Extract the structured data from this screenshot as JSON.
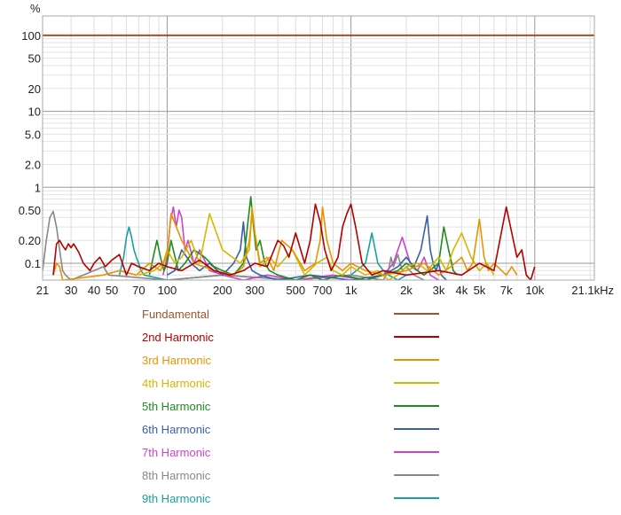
{
  "chart_data": {
    "type": "line",
    "ylabel": "%",
    "x_scale": "log",
    "y_scale": "log",
    "xlim": [
      21,
      21100
    ],
    "ylim": [
      0.06,
      180
    ],
    "x_ticks": [
      {
        "value": 21,
        "label": "21"
      },
      {
        "value": 30,
        "label": "30"
      },
      {
        "value": 40,
        "label": "40"
      },
      {
        "value": 50,
        "label": "50"
      },
      {
        "value": 70,
        "label": "70"
      },
      {
        "value": 100,
        "label": "100"
      },
      {
        "value": 200,
        "label": "200"
      },
      {
        "value": 300,
        "label": "300"
      },
      {
        "value": 500,
        "label": "500"
      },
      {
        "value": 700,
        "label": "700"
      },
      {
        "value": 1000,
        "label": "1k"
      },
      {
        "value": 2000,
        "label": "2k"
      },
      {
        "value": 3000,
        "label": "3k"
      },
      {
        "value": 4000,
        "label": "4k"
      },
      {
        "value": 5000,
        "label": "5k"
      },
      {
        "value": 7000,
        "label": "7k"
      },
      {
        "value": 10000,
        "label": "10k"
      },
      {
        "value": 21100,
        "label": "21.1kHz"
      }
    ],
    "y_ticks": [
      {
        "value": 100,
        "label": "100"
      },
      {
        "value": 50,
        "label": "50"
      },
      {
        "value": 20,
        "label": "20"
      },
      {
        "value": 10,
        "label": "10"
      },
      {
        "value": 5,
        "label": "5.0"
      },
      {
        "value": 2,
        "label": "2.0"
      },
      {
        "value": 1,
        "label": "1"
      },
      {
        "value": 0.5,
        "label": "0.50"
      },
      {
        "value": 0.2,
        "label": "0.20"
      },
      {
        "value": 0.1,
        "label": "0.1"
      }
    ],
    "grid": true,
    "legend_position": "bottom",
    "series": [
      {
        "name": "Fundamental",
        "color": "#a0522d",
        "x": [
          21,
          21100
        ],
        "y": [
          100,
          100
        ]
      },
      {
        "name": "2nd Harmonic",
        "color": "#b30000",
        "x": [
          24,
          25,
          26,
          27,
          28,
          29,
          30,
          31,
          33,
          35,
          38,
          40,
          43,
          46,
          50,
          55,
          60,
          64,
          70,
          80,
          90,
          100,
          120,
          150,
          180,
          220,
          260,
          300,
          350,
          400,
          430,
          460,
          500,
          560,
          600,
          640,
          680,
          720,
          780,
          850,
          900,
          950,
          1000,
          1060,
          1150,
          1300,
          1500,
          2000,
          3000,
          4000,
          5000,
          6000,
          7000,
          8000,
          8500,
          9000,
          9500,
          10000
        ],
        "y": [
          0.07,
          0.18,
          0.2,
          0.17,
          0.15,
          0.18,
          0.16,
          0.18,
          0.14,
          0.1,
          0.08,
          0.1,
          0.12,
          0.09,
          0.11,
          0.13,
          0.07,
          0.1,
          0.09,
          0.08,
          0.1,
          0.09,
          0.08,
          0.11,
          0.08,
          0.07,
          0.08,
          0.1,
          0.09,
          0.2,
          0.17,
          0.12,
          0.25,
          0.1,
          0.2,
          0.6,
          0.35,
          0.15,
          0.08,
          0.12,
          0.3,
          0.45,
          0.6,
          0.3,
          0.1,
          0.07,
          0.08,
          0.07,
          0.08,
          0.07,
          0.1,
          0.08,
          0.55,
          0.12,
          0.15,
          0.07,
          0.06,
          0.09
        ]
      },
      {
        "name": "3rd Harmonic",
        "color": "#e69500",
        "x": [
          24,
          25,
          26,
          27,
          45,
          55,
          68,
          80,
          92,
          100,
          105,
          120,
          140,
          180,
          230,
          260,
          280,
          290,
          300,
          320,
          350,
          380,
          420,
          480,
          560,
          640,
          680,
          700,
          740,
          800,
          900,
          1000,
          1200,
          1500,
          2000,
          2500,
          3000,
          3500,
          4000,
          4300,
          4600,
          5000,
          5300,
          5600,
          6000,
          7000,
          7500,
          8000
        ],
        "y": [
          0.07,
          0.1,
          0.09,
          0.06,
          0.07,
          0.08,
          0.07,
          0.1,
          0.08,
          0.13,
          0.45,
          0.2,
          0.1,
          0.08,
          0.07,
          0.09,
          0.2,
          0.5,
          0.25,
          0.1,
          0.12,
          0.08,
          0.2,
          0.15,
          0.08,
          0.1,
          0.2,
          0.55,
          0.2,
          0.1,
          0.08,
          0.1,
          0.08,
          0.07,
          0.08,
          0.1,
          0.07,
          0.09,
          0.12,
          0.08,
          0.1,
          0.38,
          0.12,
          0.08,
          0.1,
          0.07,
          0.09,
          0.07
        ]
      },
      {
        "name": "4th Harmonic",
        "color": "#d4b800",
        "x": [
          70,
          85,
          95,
          100,
          110,
          120,
          135,
          150,
          170,
          200,
          250,
          280,
          290,
          300,
          320,
          340,
          360,
          400,
          480,
          560,
          650,
          740,
          800,
          900,
          1000,
          1200,
          1400,
          1600,
          1800,
          2000,
          2300,
          2600,
          3000,
          3300,
          3600,
          4000,
          4500,
          5000,
          5500,
          6000
        ],
        "y": [
          0.07,
          0.08,
          0.1,
          0.15,
          0.1,
          0.12,
          0.2,
          0.1,
          0.45,
          0.15,
          0.1,
          0.15,
          0.55,
          0.25,
          0.09,
          0.1,
          0.12,
          0.09,
          0.15,
          0.07,
          0.1,
          0.12,
          0.08,
          0.07,
          0.09,
          0.07,
          0.08,
          0.06,
          0.07,
          0.09,
          0.1,
          0.08,
          0.12,
          0.08,
          0.15,
          0.25,
          0.12,
          0.08,
          0.1,
          0.07
        ]
      },
      {
        "name": "5th Harmonic",
        "color": "#1e8c1e",
        "x": [
          80,
          84,
          88,
          92,
          96,
          100,
          105,
          115,
          125,
          140,
          160,
          180,
          200,
          230,
          260,
          275,
          285,
          295,
          305,
          320,
          340,
          360,
          400,
          500,
          600,
          700,
          900,
          1200,
          1500,
          1800,
          2000,
          2500,
          3000,
          3200,
          3400,
          3600,
          3800
        ],
        "y": [
          0.07,
          0.12,
          0.2,
          0.12,
          0.08,
          0.1,
          0.2,
          0.08,
          0.1,
          0.15,
          0.12,
          0.09,
          0.08,
          0.07,
          0.1,
          0.35,
          0.75,
          0.3,
          0.15,
          0.2,
          0.1,
          0.08,
          0.07,
          0.06,
          0.07,
          0.06,
          0.07,
          0.06,
          0.07,
          0.08,
          0.1,
          0.07,
          0.1,
          0.3,
          0.15,
          0.08,
          0.07
        ]
      },
      {
        "name": "6th Harmonic",
        "color": "#3a5fa8",
        "x": [
          100,
          110,
          120,
          135,
          150,
          170,
          200,
          230,
          250,
          260,
          270,
          290,
          320,
          400,
          600,
          1000,
          1500,
          1800,
          2000,
          2200,
          2400,
          2600,
          2700,
          2800,
          2900,
          3000,
          3100,
          3300
        ],
        "y": [
          0.07,
          0.08,
          0.15,
          0.1,
          0.08,
          0.1,
          0.07,
          0.1,
          0.15,
          0.35,
          0.12,
          0.08,
          0.07,
          0.06,
          0.07,
          0.06,
          0.07,
          0.09,
          0.12,
          0.09,
          0.15,
          0.42,
          0.15,
          0.1,
          0.08,
          0.1,
          0.07,
          0.06
        ]
      },
      {
        "name": "7th Harmonic",
        "color": "#cc44cc",
        "x": [
          95,
          100,
          104,
          108,
          112,
          116,
          120,
          125,
          130,
          140,
          150,
          170,
          200,
          260,
          350,
          500,
          800,
          1200,
          1500,
          1700,
          1900,
          2100,
          2300,
          2500,
          2700,
          3000
        ],
        "y": [
          0.07,
          0.12,
          0.35,
          0.55,
          0.3,
          0.5,
          0.4,
          0.15,
          0.2,
          0.1,
          0.15,
          0.08,
          0.07,
          0.06,
          0.07,
          0.06,
          0.07,
          0.06,
          0.07,
          0.1,
          0.22,
          0.1,
          0.08,
          0.12,
          0.07,
          0.06
        ]
      },
      {
        "name": "8th Harmonic",
        "color": "#888888",
        "x": [
          21,
          22,
          23,
          24,
          25,
          26,
          27,
          28,
          30,
          35,
          40,
          45,
          48,
          100,
          200,
          500,
          1000,
          1500,
          1600,
          1650,
          1700,
          1800,
          1900,
          2000,
          2200,
          2500
        ],
        "y": [
          0.08,
          0.2,
          0.4,
          0.48,
          0.3,
          0.15,
          0.08,
          0.07,
          0.06,
          0.07,
          0.08,
          0.09,
          0.07,
          0.06,
          0.07,
          0.06,
          0.07,
          0.06,
          0.08,
          0.12,
          0.09,
          0.13,
          0.08,
          0.09,
          0.07,
          0.06
        ]
      },
      {
        "name": "9th Harmonic",
        "color": "#1aa0a0",
        "x": [
          55,
          58,
          60,
          62,
          64,
          66,
          68,
          70,
          72,
          75,
          100,
          200,
          500,
          1000,
          1200,
          1300,
          1400,
          1500,
          1600,
          1800,
          2000
        ],
        "y": [
          0.07,
          0.12,
          0.22,
          0.3,
          0.22,
          0.15,
          0.12,
          0.1,
          0.08,
          0.07,
          0.06,
          0.07,
          0.06,
          0.07,
          0.1,
          0.25,
          0.1,
          0.08,
          0.07,
          0.06,
          0.07
        ]
      }
    ]
  }
}
